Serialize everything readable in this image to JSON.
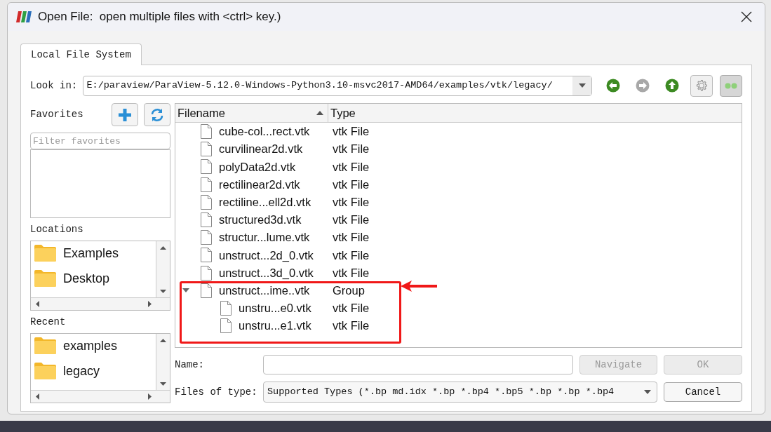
{
  "window": {
    "title": "Open File:  open multiple files with <ctrl> key.)"
  },
  "tabs": [
    {
      "label": "Local File System",
      "selected": true
    }
  ],
  "look_in": {
    "label": "Look in:",
    "value": "E:/paraview/ParaView-5.12.0-Windows-Python3.10-msvc2017-AMD64/examples/vtk/legacy/"
  },
  "nav_buttons": [
    {
      "kind": "back",
      "disabled": false
    },
    {
      "kind": "forward",
      "disabled": true
    },
    {
      "kind": "up",
      "disabled": false
    },
    {
      "kind": "settings",
      "disabled": false
    },
    {
      "kind": "toggle",
      "on": true
    }
  ],
  "favorites": {
    "label": "Favorites",
    "filter_placeholder": "Filter favorites"
  },
  "locations": {
    "label": "Locations",
    "items": [
      {
        "label": "Examples"
      },
      {
        "label": "Desktop"
      }
    ]
  },
  "recent": {
    "label": "Recent",
    "items": [
      {
        "label": "examples"
      },
      {
        "label": "legacy"
      }
    ]
  },
  "file_table": {
    "columns": [
      {
        "label": "Filename",
        "sorted": true
      },
      {
        "label": "Type",
        "sorted": false
      }
    ],
    "rows": [
      {
        "name": "cube-col...rect.vtk",
        "type": "vtk File"
      },
      {
        "name": "curvilinear2d.vtk",
        "type": "vtk File"
      },
      {
        "name": "polyData2d.vtk",
        "type": "vtk File"
      },
      {
        "name": "rectilinear2d.vtk",
        "type": "vtk File"
      },
      {
        "name": "rectiline...ell2d.vtk",
        "type": "vtk File"
      },
      {
        "name": "structured3d.vtk",
        "type": "vtk File"
      },
      {
        "name": "structur...lume.vtk",
        "type": "vtk File"
      },
      {
        "name": "unstruct...2d_0.vtk",
        "type": "vtk File"
      },
      {
        "name": "unstruct...3d_0.vtk",
        "type": "vtk File"
      },
      {
        "name": "unstruct...ime..vtk",
        "type": "Group",
        "expanded": true,
        "children": [
          {
            "name": "unstru...e0.vtk",
            "type": "vtk File"
          },
          {
            "name": "unstru...e1.vtk",
            "type": "vtk File"
          }
        ]
      }
    ]
  },
  "name_field": {
    "label": "Name:"
  },
  "files_of_type": {
    "label": "Files of type:",
    "value": "Supported Types (*.bp md.idx *.bp *.bp4 *.bp5 *.bp *.bp *.bp4"
  },
  "buttons": [
    {
      "label": "Navigate",
      "disabled": true
    },
    {
      "label": "OK",
      "disabled": true
    },
    {
      "label": "Cancel",
      "disabled": false
    }
  ]
}
